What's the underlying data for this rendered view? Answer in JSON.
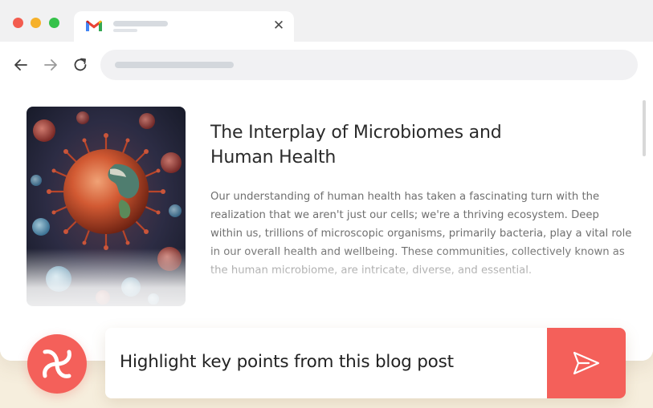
{
  "browser": {
    "window_controls": [
      "close",
      "minimize",
      "maximize"
    ],
    "tab": {
      "icon": "gmail-icon",
      "close_label": "✕"
    },
    "nav": {
      "back_icon": "arrow-left-icon",
      "forward_icon": "arrow-right-icon",
      "reload_icon": "reload-icon"
    }
  },
  "article": {
    "image_subject": "microbes-illustration",
    "title": "The Interplay of Microbiomes and Human Health",
    "body": "Our understanding of human health has taken a fascinating turn with the realization that we aren't just our cells; we're a thriving ecosystem. Deep within us, trillions of microscopic organisms, primarily bacteria, play a vital role in our overall health and wellbeing. These communities, collectively known as the human microbiome, are intricate, diverse, and essential."
  },
  "assistant": {
    "logo_icon": "brand-swirl-icon",
    "prompt": "Highlight key points from this blog post",
    "send_icon": "send-icon"
  },
  "colors": {
    "accent": "#f4605a",
    "page_background": "#f6eedd",
    "title_text": "#2a2a2a",
    "body_text": "#6f6f6f"
  }
}
